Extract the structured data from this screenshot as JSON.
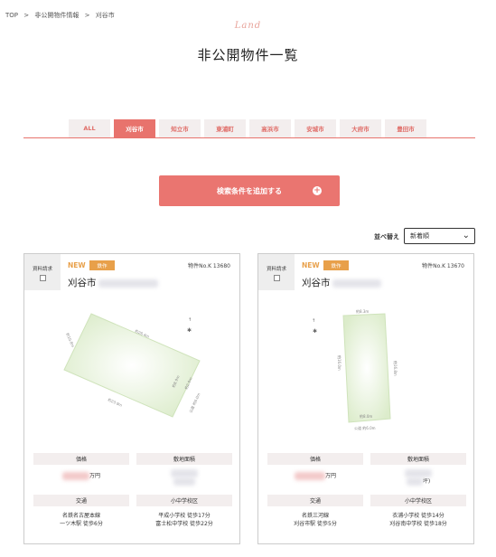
{
  "breadcrumb": {
    "items": [
      "TOP",
      ">",
      "非公開物件情報",
      ">",
      "刈谷市"
    ]
  },
  "header": {
    "script": "Land",
    "title": "非公開物件一覧"
  },
  "tabs": [
    {
      "label": "ALL",
      "active": false
    },
    {
      "label": "刈谷市",
      "active": true
    },
    {
      "label": "知立市",
      "active": false
    },
    {
      "label": "東浦町",
      "active": false
    },
    {
      "label": "高浜市",
      "active": false
    },
    {
      "label": "安城市",
      "active": false
    },
    {
      "label": "大府市",
      "active": false
    },
    {
      "label": "豊田市",
      "active": false
    }
  ],
  "search": {
    "label": "検索条件を追加する",
    "icon": "plus-circle-icon"
  },
  "sort": {
    "label": "並べ替え",
    "selected": "新着順"
  },
  "colors": {
    "accent": "#e8736d",
    "badge": "#e8a04a",
    "tab_bg": "#f3eeee"
  },
  "properties": [
    {
      "request_label": "資料請求",
      "new_label": "NEW",
      "badge": "鉄作",
      "property_no": "物件No.K 13680",
      "city": "刈谷市",
      "plot_labels": [
        "約26.4m",
        "約10.8m",
        "約23.9m",
        "約8.9m",
        "約2.0m",
        "公道 約6.0m"
      ],
      "price_label": "価格",
      "price_suffix": "万円",
      "area_label": "敷地面積",
      "traffic_label": "交通",
      "traffic_lines": [
        "名鉄名古屋本線",
        "一ツ木駅 徒歩6分"
      ],
      "school_label": "小中学校区",
      "school_lines": [
        "平成小学校 徒歩17分",
        "富士松中学校 徒歩22分"
      ]
    },
    {
      "request_label": "資料請求",
      "new_label": "NEW",
      "badge": "鉄作",
      "property_no": "物件No.K 13670",
      "city": "刈谷市",
      "plot_labels": [
        "約8.3m",
        "約16.0m",
        "約16.8m",
        "約8.0m",
        "公道 約6.0m"
      ],
      "price_label": "価格",
      "price_suffix": "万円",
      "area_label": "敷地面積",
      "area_suffix": "坪)",
      "traffic_label": "交通",
      "traffic_lines": [
        "名鉄三河線",
        "刈谷市駅 徒歩5分"
      ],
      "school_label": "小中学校区",
      "school_lines": [
        "衣浦小学校 徒歩14分",
        "刈谷南中学校 徒歩18分"
      ]
    }
  ]
}
